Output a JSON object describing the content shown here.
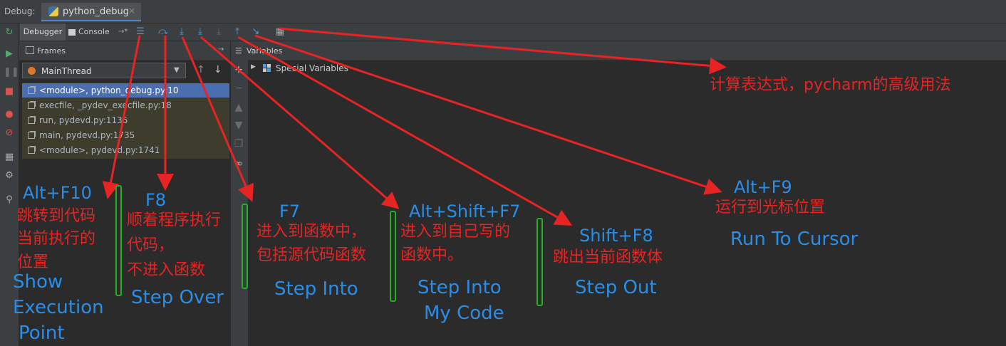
{
  "topbar": {
    "debug_label": "Debug:",
    "run_tab": "python_debug",
    "close_glyph": "×"
  },
  "tabs": {
    "debugger": "Debugger",
    "console": "Console",
    "console_pin": "→*"
  },
  "frames": {
    "title": "Frames",
    "pin": "→",
    "thread": "MainThread",
    "rows": [
      "<module>, python_debug.py:10",
      "execfile, _pydev_execfile.py:18",
      "run, pydevd.py:1135",
      "main, pydevd.py:1735",
      "<module>, pydevd.py:1741"
    ]
  },
  "variables": {
    "title": "Variables",
    "special": "Special Variables"
  },
  "annotations": {
    "evaluate": "计算表达式，pycharm的高级用法",
    "show_key": "Alt+F10",
    "show_zh": [
      "跳转到代码",
      "当前执行的",
      "位置"
    ],
    "show_en": [
      "Show",
      "Execution",
      "Point"
    ],
    "over_key": "F8",
    "over_zh": [
      "顺着程序执行",
      "代码，",
      "不进入函数"
    ],
    "over_en": "Step Over",
    "into_key": "F7",
    "into_zh": [
      "进入到函数中，",
      "包括源代码函数"
    ],
    "into_en": "Step Into",
    "mycode_key": "Alt+Shift+F7",
    "mycode_zh": [
      "进入到自己写的",
      "函数中。"
    ],
    "mycode_en": [
      "Step Into",
      "My Code"
    ],
    "out_key": "Shift+F8",
    "out_zh": "跳出当前函数体",
    "out_en": "Step Out",
    "cursor_key": "Alt+F9",
    "cursor_zh": "运行到光标位置",
    "cursor_en": "Run To Cursor"
  },
  "colors": {
    "annotation_red": "#e82323",
    "annotation_blue": "#2a8ee8",
    "bracket_green": "#22b122",
    "selection_blue": "#4b6eaf"
  },
  "icons": [
    "rerun-icon",
    "resume-icon",
    "pause-icon",
    "stop-icon",
    "view-breakpoints-icon",
    "mute-breakpoints-icon",
    "layout-icon",
    "settings-icon",
    "pin-icon",
    "show-execution-point-icon",
    "step-over-icon",
    "step-into-icon",
    "step-into-my-code-icon",
    "force-step-into-icon",
    "step-out-icon",
    "run-to-cursor-icon",
    "evaluate-expression-icon"
  ]
}
